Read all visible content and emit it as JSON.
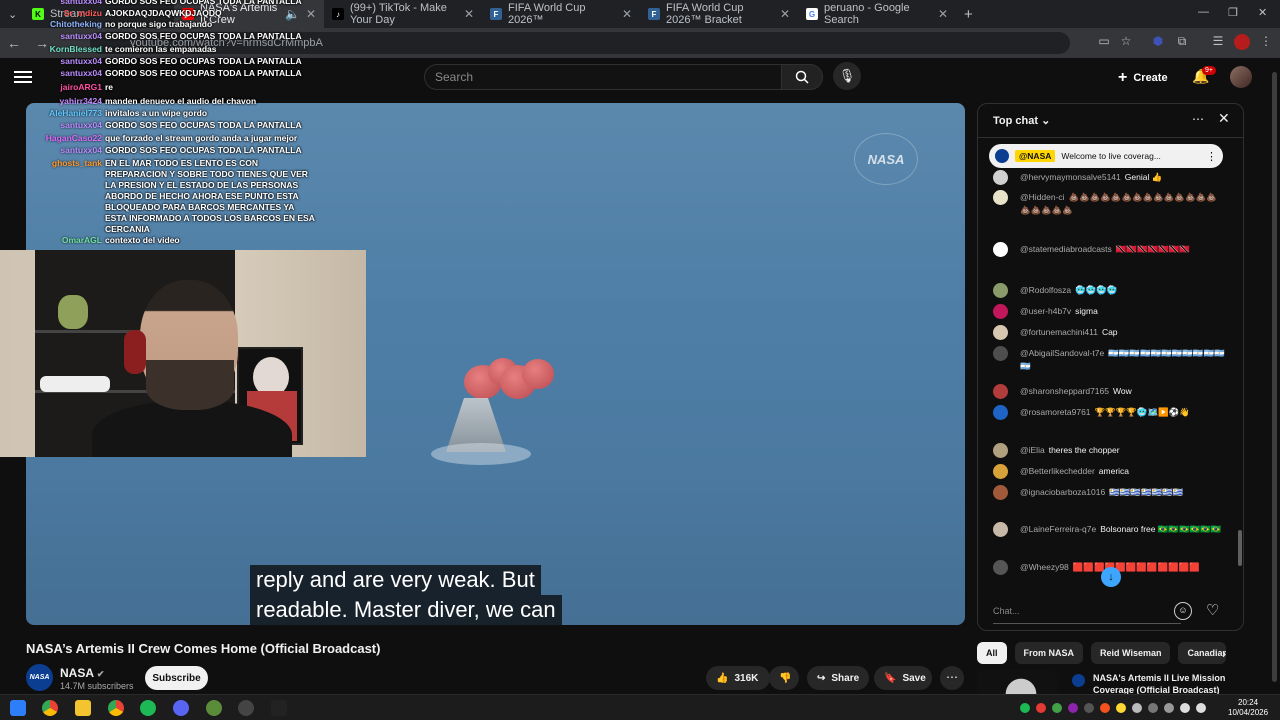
{
  "browser": {
    "tabs": [
      {
        "title": "Stream",
        "favicon_color": "#53fc18",
        "favicon_glyph": "K"
      },
      {
        "title": "NASA's Artemis II Crew",
        "favicon_color": "#ff0000",
        "favicon_glyph": "▶"
      },
      {
        "title": "(99+) TikTok - Make Your Day",
        "favicon_color": "#000000",
        "favicon_glyph": "♪"
      },
      {
        "title": "FIFA World Cup 2026™",
        "favicon_color": "#326295",
        "favicon_glyph": "F"
      },
      {
        "title": "FIFA World Cup 2026™ Bracket",
        "favicon_color": "#326295",
        "favicon_glyph": "F"
      },
      {
        "title": "peruano - Google Search",
        "favicon_color": "#4285f4",
        "favicon_glyph": "G"
      }
    ],
    "url": "youtube.com/watch?v=hrmsdCrMmpbA"
  },
  "youtube": {
    "search_placeholder": "Search",
    "create_label": "Create",
    "notif_badge": "9+"
  },
  "overlay_chat": [
    {
      "name": "santuxx04",
      "color": "#b98cff",
      "msg": "GORDO SOS FEO OCUPAS TODA LA PANTALLA"
    },
    {
      "name": "Sr_mdizu",
      "color": "#ff5b5b",
      "msg": "AJOKDAQJDAQWKDJAQDQ"
    },
    {
      "name": "Chitotheking",
      "color": "#8cb3ff",
      "msg": "no porque sigo trabajando"
    },
    {
      "name": "santuxx04",
      "color": "#b98cff",
      "msg": "GORDO SOS FEO OCUPAS TODA LA PANTALLA"
    },
    {
      "name": "KornBlessed",
      "color": "#6fe0c4",
      "msg": "te comieron las empanadas"
    },
    {
      "name": "santuxx04",
      "color": "#b98cff",
      "msg": "GORDO SOS FEO OCUPAS TODA LA PANTALLA"
    },
    {
      "name": "santuxx04",
      "color": "#b98cff",
      "msg": "GORDO SOS FEO OCUPAS TODA LA PANTALLA"
    },
    {
      "name": "jairoARG1",
      "color": "#ff4fa0",
      "msg": "re"
    },
    {
      "name": "yahirr3424",
      "color": "#c58cff",
      "msg": "manden denuevo el audio del chavon"
    },
    {
      "name": "AleHaniel773",
      "color": "#5ec8ff",
      "msg": "invitalos a un wipe gordo"
    },
    {
      "name": "santuxx04",
      "color": "#b98cff",
      "msg": "GORDO SOS FEO OCUPAS TODA LA PANTALLA"
    },
    {
      "name": "HaganCaso22",
      "color": "#d86bff",
      "msg": "que forzado el stream gordo anda a jugar mejor"
    },
    {
      "name": "santuxx04",
      "color": "#b98cff",
      "msg": "GORDO SOS FEO OCUPAS TODA LA PANTALLA"
    },
    {
      "name": "ghosts_tank",
      "color": "#ff9a2e",
      "msg": "EN EL MAR TODO ES LENTO ES CON PREPARACION Y SOBRE TODO TIENES QUE VER LA PRESION Y EL ESTADO DE LAS PERSONAS ABORDO DE HECHO AHORA ESE PUNTO ESTA BLOQUEADO PARA BARCOS MERCANTES YA ESTA INFORMADO A TODOS LOS BARCOS EN ESA CERCANIA"
    },
    {
      "name": "OmarAGL",
      "color": "#6fe0a0",
      "msg": "contexto del video"
    }
  ],
  "video": {
    "watermark": "NASA",
    "caption_lines": [
      "reply and are very weak. But",
      "readable. Master diver, we can"
    ]
  },
  "meta": {
    "title": "NASA’s Artemis II Crew Comes Home (Official Broadcast)",
    "channel": "NASA",
    "subscribers": "14.7M subscribers",
    "subscribe_label": "Subscribe",
    "likes": "316K",
    "share_label": "Share",
    "save_label": "Save"
  },
  "live_chat": {
    "header": "Top chat",
    "pinned_name": "@NASA",
    "pinned_text": "Welcome to live coverag...",
    "input_placeholder": "Chat...",
    "messages": [
      {
        "user": "@hervymaymonsalve5141",
        "text": "Genial 👍",
        "av": "#cfcfcf"
      },
      {
        "user": "@Hidden-ci",
        "text": "💩💩💩💩💩💩💩💩💩💩💩💩💩💩💩💩💩💩💩",
        "av": "#e8e3c8"
      },
      {
        "user": "@statemediabroadcasts",
        "text": "🇹🇹🇹🇹🇹🇹🇹🇹🇹🇹🇹🇹🇹🇹",
        "av": "#ffffff"
      },
      {
        "user": "@Rodolfosza",
        "text": "🥶🥶🥶🥶",
        "av": "#8a9a6a"
      },
      {
        "user": "@user-h4b7v",
        "text": "sigma",
        "av": "#c2185b"
      },
      {
        "user": "@fortunemachini411",
        "text": "Cap",
        "av": "#d7c7b0"
      },
      {
        "user": "@AbigailSandoval-t7e",
        "text": "🇦🇷🇦🇷🇦🇷🇦🇷🇦🇷🇦🇷🇦🇷🇦🇷🇦🇷🇦🇷🇦🇷🇦🇷",
        "av": "#4e4e4e"
      },
      {
        "user": "@sharonsheppard7165",
        "text": "Wow",
        "av": "#b23b3b"
      },
      {
        "user": "@rosamoreta9761",
        "text": "🏆🏆🏆🏆🥶🗺️▶️⚽👋",
        "av": "#1e63c6"
      },
      {
        "user": "@iElia",
        "text": "theres the chopper",
        "av": "#b0a080"
      },
      {
        "user": "@Betterlikechedder",
        "text": "america",
        "av": "#d8a23a"
      },
      {
        "user": "@ignaciobarboza1016",
        "text": "🇺🇾🇺🇾🇺🇾🇺🇾🇺🇾🇺🇾🇺🇾",
        "av": "#a05a3a"
      },
      {
        "user": "@LaineFerreira-q7e",
        "text": "Bolsonaro free 🇧🇷🇧🇷🇧🇷🇧🇷🇧🇷🇧🇷",
        "av": "#c8b8a8"
      },
      {
        "user": "@Wheezy98",
        "text": "🟥🟥🟥🟥🟥🟥🟥🟥🟥🟥🟥🟥",
        "av": "#555555"
      }
    ]
  },
  "chips": [
    "All",
    "From NASA",
    "Reid Wiseman",
    "Canadian"
  ],
  "recommended": {
    "title": "NASA's Artemis II Live Mission Coverage (Official Broadcast)"
  },
  "taskbar": {
    "time": "20:24",
    "date": "10/04/2026"
  }
}
